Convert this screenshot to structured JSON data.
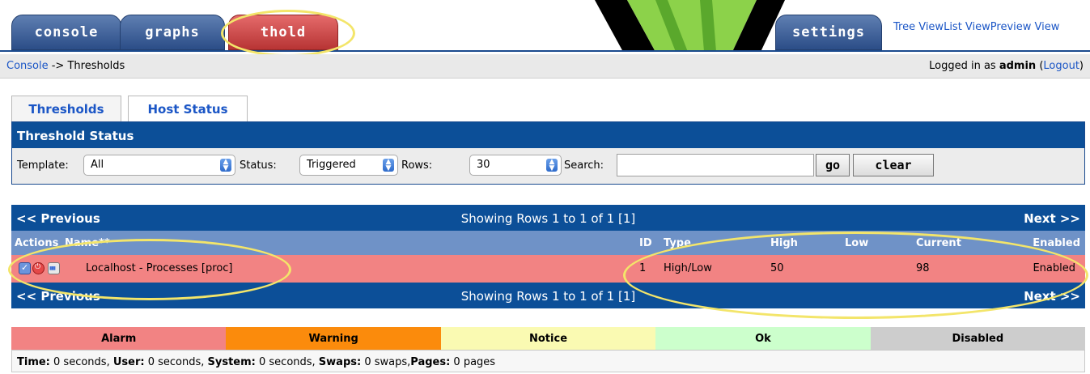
{
  "top_tabs": {
    "console": "console",
    "graphs": "graphs",
    "thold": "thold",
    "settings": "settings"
  },
  "view_links": [
    "Tree View",
    "List View",
    "Preview View"
  ],
  "breadcrumb": {
    "root": "Console",
    "separator": " -> ",
    "current": "Thresholds"
  },
  "login": {
    "prefix": "Logged in as ",
    "user": "admin",
    "logout": "Logout"
  },
  "sub_tabs": {
    "thresholds": "Thresholds",
    "host_status": "Host Status"
  },
  "filter": {
    "title": "Threshold Status",
    "template_label": "Template:",
    "template_value": "All",
    "status_label": "Status:",
    "status_value": "Triggered",
    "rows_label": "Rows:",
    "rows_value": "30",
    "search_label": "Search:",
    "search_value": "",
    "go": "go",
    "clear": "clear"
  },
  "nav": {
    "previous": "<< Previous",
    "showing": "Showing Rows 1 to 1 of 1 [1]",
    "next": "Next >>"
  },
  "table": {
    "headers": {
      "actions": "Actions",
      "name": "Name**",
      "id": "ID",
      "type": "Type",
      "high": "High",
      "low": "Low",
      "current": "Current",
      "enabled": "Enabled"
    },
    "rows": [
      {
        "name": "Localhost - Processes [proc]",
        "id": "1",
        "type": "High/Low",
        "high": "50",
        "low": "",
        "current": "98",
        "enabled": "Enabled"
      }
    ]
  },
  "legend": [
    {
      "label": "Alarm",
      "color": "#f28383"
    },
    {
      "label": "Warning",
      "color": "#fb8b0c"
    },
    {
      "label": "Notice",
      "color": "#fafab2"
    },
    {
      "label": "Ok",
      "color": "#ccffcc"
    },
    {
      "label": "Disabled",
      "color": "#cdcdcd"
    }
  ],
  "stats": {
    "time_label": "Time:",
    "time_value": " 0 seconds, ",
    "user_label": "User:",
    "user_value": " 0 seconds, ",
    "system_label": "System:",
    "system_value": " 0 seconds, ",
    "swaps_label": "Swaps:",
    "swaps_value": " 0 swaps,",
    "pages_label": "Pages:",
    "pages_value": " 0 pages"
  }
}
